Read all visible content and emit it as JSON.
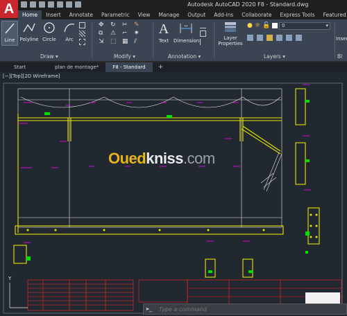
{
  "title": "Autodesk AutoCAD 2020   F8 - Standard.dwg",
  "app_logo": "A",
  "ribbon_tabs": [
    "Home",
    "Insert",
    "Annotate",
    "Parametric",
    "View",
    "Manage",
    "Output",
    "Add-ins",
    "Collaborate",
    "Express Tools",
    "Featured Apps"
  ],
  "active_ribbon_tab": "Home",
  "draw_tools": {
    "line": "Line",
    "polyline": "Polyline",
    "circle": "Circle",
    "arc": "Arc"
  },
  "annotation_tools": {
    "text": "Text",
    "dimension": "Dimension"
  },
  "layer_tools": {
    "layer_properties": "Layer\nProperties",
    "layer_value": "0"
  },
  "insert_tool": "Inser",
  "block_tool": "Bl",
  "panel_labels": {
    "draw": "Draw ▾",
    "modify": "Modify ▾",
    "annotation": "Annotation ▾",
    "layers": "Layers ▾"
  },
  "file_tabs": [
    "Start",
    "plan de montage*",
    "F8 - Standard",
    "+"
  ],
  "active_file_tab": "F8 - Standard",
  "viewport_label": "[−][Top][2D Wireframe]",
  "watermark": {
    "part1": "Oued",
    "part2": "kniss",
    "part3": ".com"
  },
  "command_placeholder": "Type a command",
  "colors": {
    "ribbon": "#3b4453",
    "drawing_bg": "#212830",
    "yellow": "#e6e600",
    "magenta": "#ff00ff",
    "red": "#ff2020",
    "green": "#00e000",
    "white": "#e8e8e8"
  }
}
